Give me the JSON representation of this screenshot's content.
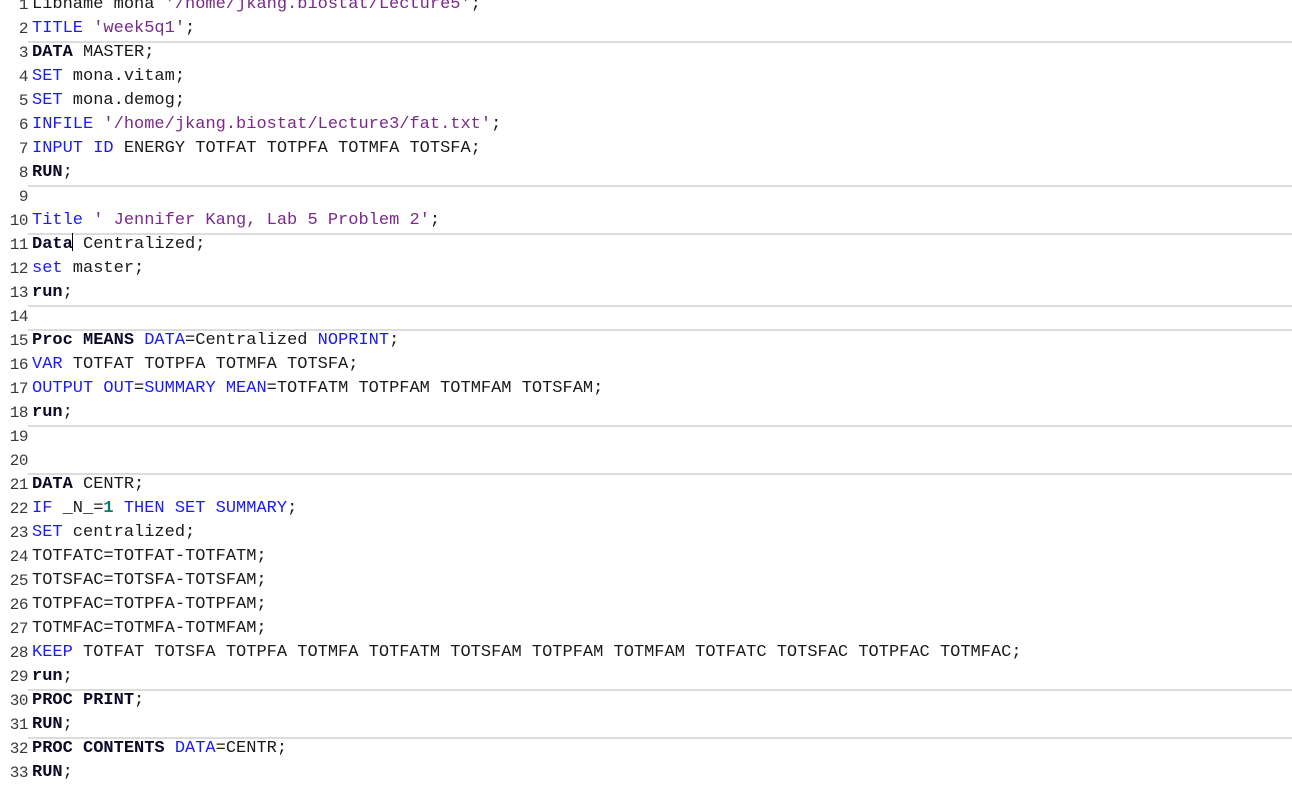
{
  "editor": {
    "lines": [
      {
        "num": "1",
        "tokens": [
          [
            "t",
            "Libname mona "
          ],
          [
            "s",
            "'/home/jkang.biostat/Lecture5'"
          ],
          [
            "t",
            ";"
          ]
        ]
      },
      {
        "num": "2",
        "tokens": [
          [
            "k",
            "TITLE "
          ],
          [
            "s",
            "'week5q1'"
          ],
          [
            "t",
            ";"
          ]
        ]
      },
      {
        "num": "3",
        "tokens": [
          [
            "b",
            "DATA"
          ],
          [
            "t",
            " MASTER;"
          ]
        ],
        "sep": true
      },
      {
        "num": "4",
        "tokens": [
          [
            "k",
            "SET"
          ],
          [
            "t",
            " mona.vitam;"
          ]
        ]
      },
      {
        "num": "5",
        "tokens": [
          [
            "k",
            "SET"
          ],
          [
            "t",
            " mona.demog;"
          ]
        ]
      },
      {
        "num": "6",
        "tokens": [
          [
            "k",
            "INFILE "
          ],
          [
            "s",
            "'/home/jkang.biostat/Lecture3/fat.txt'"
          ],
          [
            "t",
            ";"
          ]
        ]
      },
      {
        "num": "7",
        "tokens": [
          [
            "k",
            "INPUT ID"
          ],
          [
            "t",
            " ENERGY TOTFAT TOTPFA TOTMFA TOTSFA;"
          ]
        ]
      },
      {
        "num": "8",
        "tokens": [
          [
            "b",
            "RUN"
          ],
          [
            "t",
            ";"
          ]
        ]
      },
      {
        "num": "9",
        "tokens": [],
        "sep": true
      },
      {
        "num": "10",
        "tokens": [
          [
            "k",
            "Title "
          ],
          [
            "s",
            "' Jennifer Kang, Lab 5 Problem 2'"
          ],
          [
            "t",
            ";"
          ]
        ]
      },
      {
        "num": "11",
        "tokens": [
          [
            "b",
            "Data"
          ],
          [
            "c",
            ""
          ],
          [
            "t",
            " Centralized;"
          ]
        ],
        "sep": true
      },
      {
        "num": "12",
        "tokens": [
          [
            "k",
            "set"
          ],
          [
            "t",
            " master;"
          ]
        ]
      },
      {
        "num": "13",
        "tokens": [
          [
            "b",
            "run"
          ],
          [
            "t",
            ";"
          ]
        ]
      },
      {
        "num": "14",
        "tokens": [],
        "sep": true
      },
      {
        "num": "15",
        "tokens": [
          [
            "b",
            "Proc MEANS"
          ],
          [
            "t",
            " "
          ],
          [
            "k",
            "DATA"
          ],
          [
            "t",
            "=Centralized "
          ],
          [
            "k",
            "NOPRINT"
          ],
          [
            "t",
            ";"
          ]
        ],
        "sep": true
      },
      {
        "num": "16",
        "tokens": [
          [
            "k",
            "VAR"
          ],
          [
            "t",
            " TOTFAT TOTPFA TOTMFA TOTSFA;"
          ]
        ]
      },
      {
        "num": "17",
        "tokens": [
          [
            "k",
            "OUTPUT OUT"
          ],
          [
            "t",
            "="
          ],
          [
            "k",
            "SUMMARY MEAN"
          ],
          [
            "t",
            "=TOTFATM TOTPFAM TOTMFAM TOTSFAM;"
          ]
        ]
      },
      {
        "num": "18",
        "tokens": [
          [
            "b",
            "run"
          ],
          [
            "t",
            ";"
          ]
        ]
      },
      {
        "num": "19",
        "tokens": [],
        "sep": true
      },
      {
        "num": "20",
        "tokens": []
      },
      {
        "num": "21",
        "tokens": [
          [
            "b",
            "DATA"
          ],
          [
            "t",
            " CENTR;"
          ]
        ],
        "sep": true
      },
      {
        "num": "22",
        "tokens": [
          [
            "k",
            "IF"
          ],
          [
            "t",
            " _N_="
          ],
          [
            "n",
            "1"
          ],
          [
            "t",
            " "
          ],
          [
            "k",
            "THEN SET SUMMARY"
          ],
          [
            "t",
            ";"
          ]
        ]
      },
      {
        "num": "23",
        "tokens": [
          [
            "k",
            "SET"
          ],
          [
            "t",
            " centralized;"
          ]
        ]
      },
      {
        "num": "24",
        "tokens": [
          [
            "t",
            "TOTFATC=TOTFAT-TOTFATM;"
          ]
        ]
      },
      {
        "num": "25",
        "tokens": [
          [
            "t",
            "TOTSFAC=TOTSFA-TOTSFAM;"
          ]
        ]
      },
      {
        "num": "26",
        "tokens": [
          [
            "t",
            "TOTPFAC=TOTPFA-TOTPFAM;"
          ]
        ]
      },
      {
        "num": "27",
        "tokens": [
          [
            "t",
            "TOTMFAC=TOTMFA-TOTMFAM;"
          ]
        ]
      },
      {
        "num": "28",
        "tokens": [
          [
            "k",
            "KEEP"
          ],
          [
            "t",
            " TOTFAT TOTSFA TOTPFA TOTMFA TOTFATM TOTSFAM TOTPFAM TOTMFAM TOTFATC TOTSFAC TOTPFAC TOTMFAC;"
          ]
        ]
      },
      {
        "num": "29",
        "tokens": [
          [
            "b",
            "run"
          ],
          [
            "t",
            ";"
          ]
        ]
      },
      {
        "num": "30",
        "tokens": [
          [
            "b",
            "PROC PRINT"
          ],
          [
            "t",
            ";"
          ]
        ],
        "sep": true
      },
      {
        "num": "31",
        "tokens": [
          [
            "b",
            "RUN"
          ],
          [
            "t",
            ";"
          ]
        ]
      },
      {
        "num": "32",
        "tokens": [
          [
            "b",
            "PROC CONTENTS"
          ],
          [
            "t",
            " "
          ],
          [
            "k",
            "DATA"
          ],
          [
            "t",
            "=CENTR;"
          ]
        ],
        "sep": true
      },
      {
        "num": "33",
        "tokens": [
          [
            "b",
            "RUN"
          ],
          [
            "t",
            ";"
          ]
        ]
      }
    ]
  }
}
